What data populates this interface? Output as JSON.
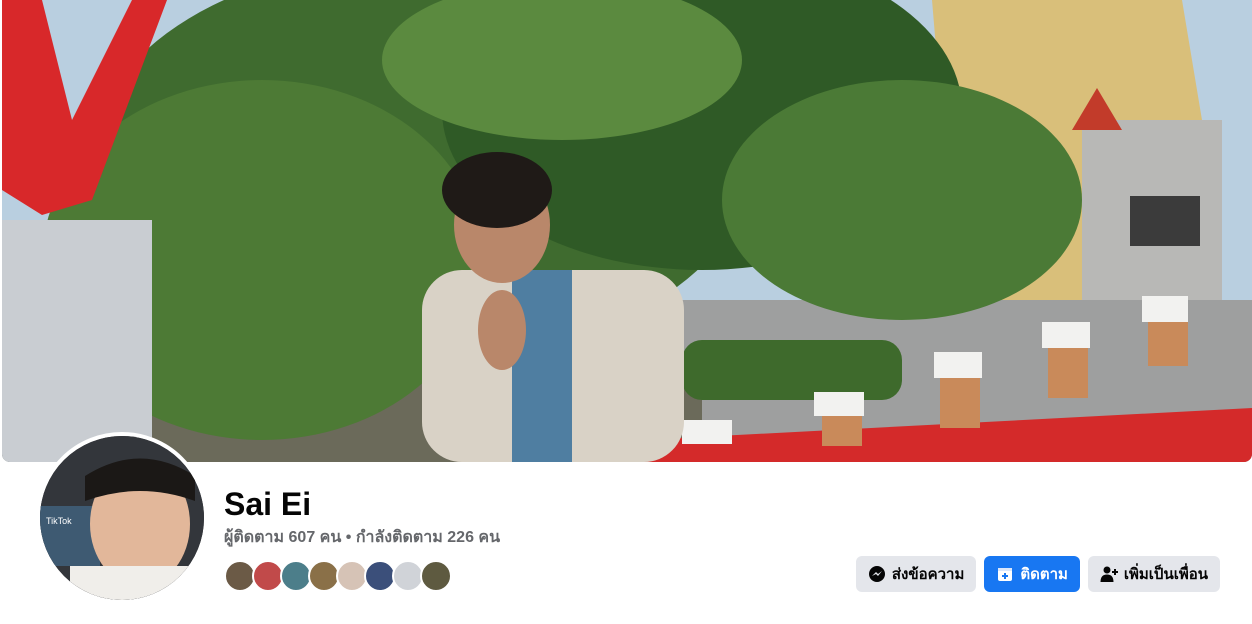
{
  "profile": {
    "name": "Sai Ei",
    "followers_label": "ผู้ติดตาม 607 คน",
    "separator": "•",
    "following_label": "กำลังติดตาม 226 คน"
  },
  "friends": {
    "count_shown": 8,
    "colors": [
      "#6b5a46",
      "#c14a4a",
      "#4c7e8a",
      "#8a7048",
      "#d6c3b6",
      "#3b4f7a",
      "#d0d3d8",
      "#5e5a40"
    ]
  },
  "actions": {
    "message_label": "ส่งข้อความ",
    "follow_label": "ติดตาม",
    "add_friend_label": "เพิ่มเป็นเพื่อน"
  },
  "colors": {
    "primary": "#1877f2",
    "secondary_button": "#e4e6eb",
    "muted_text": "#65676b"
  },
  "icons": {
    "message": "messenger-icon",
    "follow": "follow-page-icon",
    "add_friend": "add-friend-icon"
  }
}
